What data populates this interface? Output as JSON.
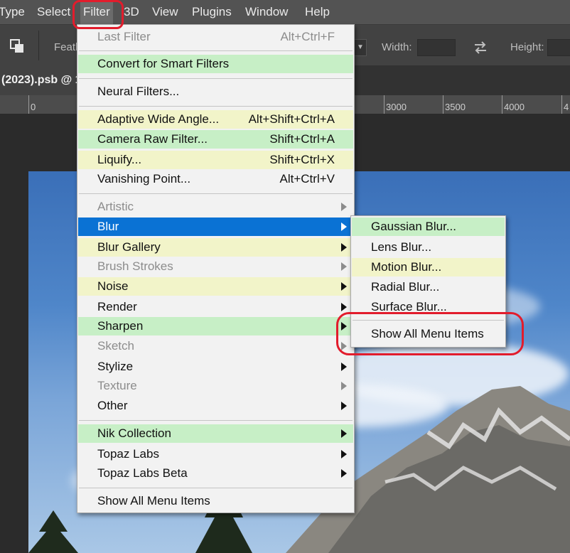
{
  "menubar": {
    "items": [
      "Type",
      "Select",
      "Filter",
      "3D",
      "View",
      "Plugins",
      "Window",
      "Help"
    ]
  },
  "options": {
    "feather_label": "Feath",
    "width_label": "Width:",
    "height_label": "Height:"
  },
  "document": {
    "tab_title": "(2023).psb @ 1"
  },
  "ruler": {
    "labels": [
      "0",
      "3000",
      "3500",
      "4000",
      "4"
    ]
  },
  "filter_menu": {
    "items": [
      {
        "label": "Last Filter",
        "shortcut": "Alt+Ctrl+F",
        "state": "disabled"
      },
      {
        "label": "Convert for Smart Filters",
        "shortcut": "",
        "state": "green"
      },
      {
        "label": "Neural Filters...",
        "shortcut": "",
        "state": "normal"
      },
      {
        "label": "Adaptive Wide Angle...",
        "shortcut": "Alt+Shift+Ctrl+A",
        "state": "yellow"
      },
      {
        "label": "Camera Raw Filter...",
        "shortcut": "Shift+Ctrl+A",
        "state": "green"
      },
      {
        "label": "Liquify...",
        "shortcut": "Shift+Ctrl+X",
        "state": "yellow"
      },
      {
        "label": "Vanishing Point...",
        "shortcut": "Alt+Ctrl+V",
        "state": "normal"
      },
      {
        "label": "Artistic",
        "shortcut": "",
        "state": "disabled"
      },
      {
        "label": "Blur",
        "shortcut": "",
        "state": "selected"
      },
      {
        "label": "Blur Gallery",
        "shortcut": "",
        "state": "yellow"
      },
      {
        "label": "Brush Strokes",
        "shortcut": "",
        "state": "disabled"
      },
      {
        "label": "Noise",
        "shortcut": "",
        "state": "yellow"
      },
      {
        "label": "Render",
        "shortcut": "",
        "state": "normal"
      },
      {
        "label": "Sharpen",
        "shortcut": "",
        "state": "green"
      },
      {
        "label": "Sketch",
        "shortcut": "",
        "state": "disabled"
      },
      {
        "label": "Stylize",
        "shortcut": "",
        "state": "normal"
      },
      {
        "label": "Texture",
        "shortcut": "",
        "state": "disabled"
      },
      {
        "label": "Other",
        "shortcut": "",
        "state": "normal"
      },
      {
        "label": "Nik Collection",
        "shortcut": "",
        "state": "green"
      },
      {
        "label": "Topaz Labs",
        "shortcut": "",
        "state": "normal"
      },
      {
        "label": "Topaz Labs Beta",
        "shortcut": "",
        "state": "normal"
      },
      {
        "label": "Show All Menu Items",
        "shortcut": "",
        "state": "normal"
      }
    ]
  },
  "blur_submenu": {
    "items": [
      {
        "label": "Gaussian Blur...",
        "state": "green"
      },
      {
        "label": "Lens Blur...",
        "state": "normal"
      },
      {
        "label": "Motion Blur...",
        "state": "yellow"
      },
      {
        "label": "Radial Blur...",
        "state": "normal"
      },
      {
        "label": "Surface Blur...",
        "state": "normal"
      },
      {
        "label": "Show All Menu Items",
        "state": "normal"
      }
    ]
  },
  "colors": {
    "selected": "#0a72d4",
    "highlight_green": "#c7efc6",
    "highlight_yellow": "#f2f4c9",
    "annotation_red": "#e21c2c"
  }
}
